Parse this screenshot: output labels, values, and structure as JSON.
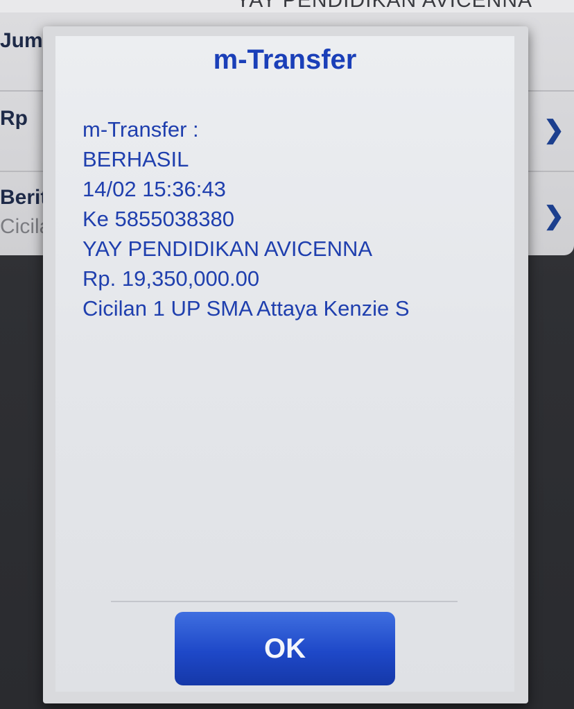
{
  "background": {
    "header_text": "YAY PENDIDIKAN AVICENNA",
    "rows": [
      {
        "label": "Jum",
        "sub": ""
      },
      {
        "label": "Rp",
        "sub": ""
      },
      {
        "label": "Berit",
        "sub": "Cicila"
      }
    ]
  },
  "dialog": {
    "title": "m-Transfer",
    "lines": [
      "m-Transfer :",
      "BERHASIL",
      "14/02 15:36:43",
      "Ke 5855038380",
      "YAY PENDIDIKAN AVICENNA",
      "Rp. 19,350,000.00",
      "Cicilan 1 UP SMA Attaya Kenzie S"
    ],
    "ok_label": "OK"
  },
  "colors": {
    "dialog_text": "#1f3fae",
    "button": "#1e48c8"
  },
  "icons": {
    "row_chevron": "chevron-right-icon"
  }
}
